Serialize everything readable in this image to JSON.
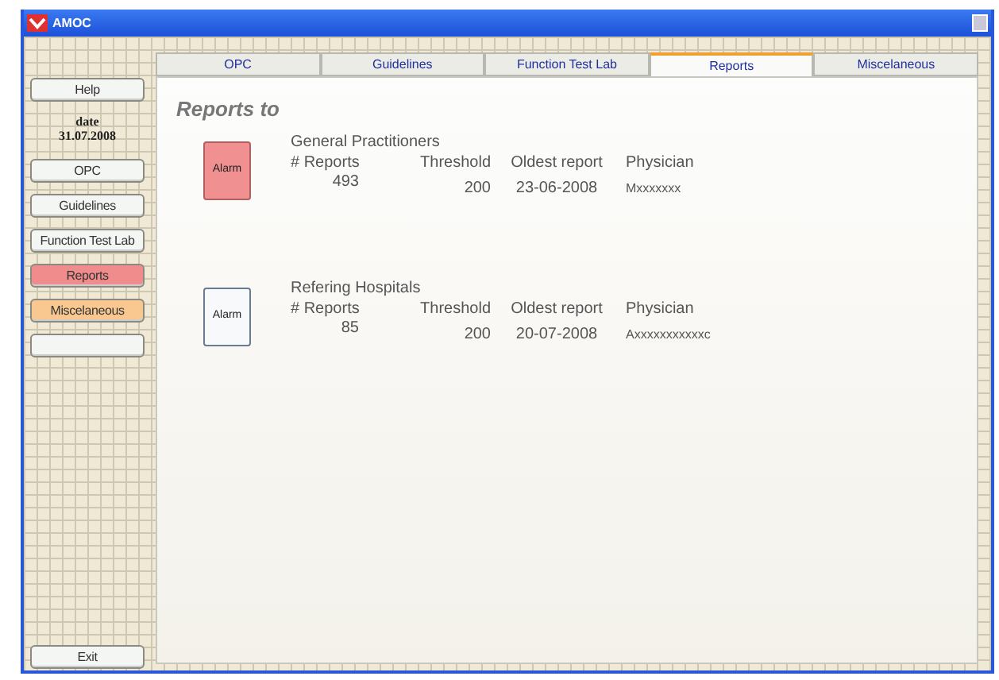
{
  "window": {
    "title": "AMOC"
  },
  "sidebar": {
    "help": "Help",
    "date_label": "date",
    "date": "31.07.2008",
    "nav": [
      {
        "label": "OPC",
        "color": "#f4f6f4"
      },
      {
        "label": "Guidelines",
        "color": "#f4f6f4"
      },
      {
        "label": "Function Test Lab",
        "color": "#f4f6f4"
      },
      {
        "label": "Reports",
        "color": "#f08c8c"
      },
      {
        "label": "Miscelaneous",
        "color": "#f8c890"
      },
      {
        "color": "#f4f6f4"
      }
    ],
    "exit": "Exit"
  },
  "tabs": [
    {
      "label": "OPC",
      "selected": false
    },
    {
      "label": "Guidelines",
      "selected": false
    },
    {
      "label": "Function Test Lab",
      "selected": false
    },
    {
      "label": "Reports",
      "selected": true
    },
    {
      "label": "Miscelaneous",
      "selected": false
    }
  ],
  "heading": "Reports to",
  "groups": [
    {
      "alarm_label": "Alarm",
      "alarm": true,
      "title": "General Practitioners",
      "columns": [
        "# Reports",
        "Threshold",
        "Oldest report",
        "Physician"
      ],
      "values": [
        "493",
        "200",
        "23-06-2008",
        "Mxxxxxxx"
      ]
    },
    {
      "alarm_label": "Alarm",
      "alarm": false,
      "title": "Refering Hospitals",
      "columns": [
        "# Reports",
        "Threshold",
        "Oldest report",
        "Physician"
      ],
      "values": [
        "85",
        "200",
        "20-07-2008",
        "Axxxxxxxxxxxc"
      ]
    }
  ]
}
